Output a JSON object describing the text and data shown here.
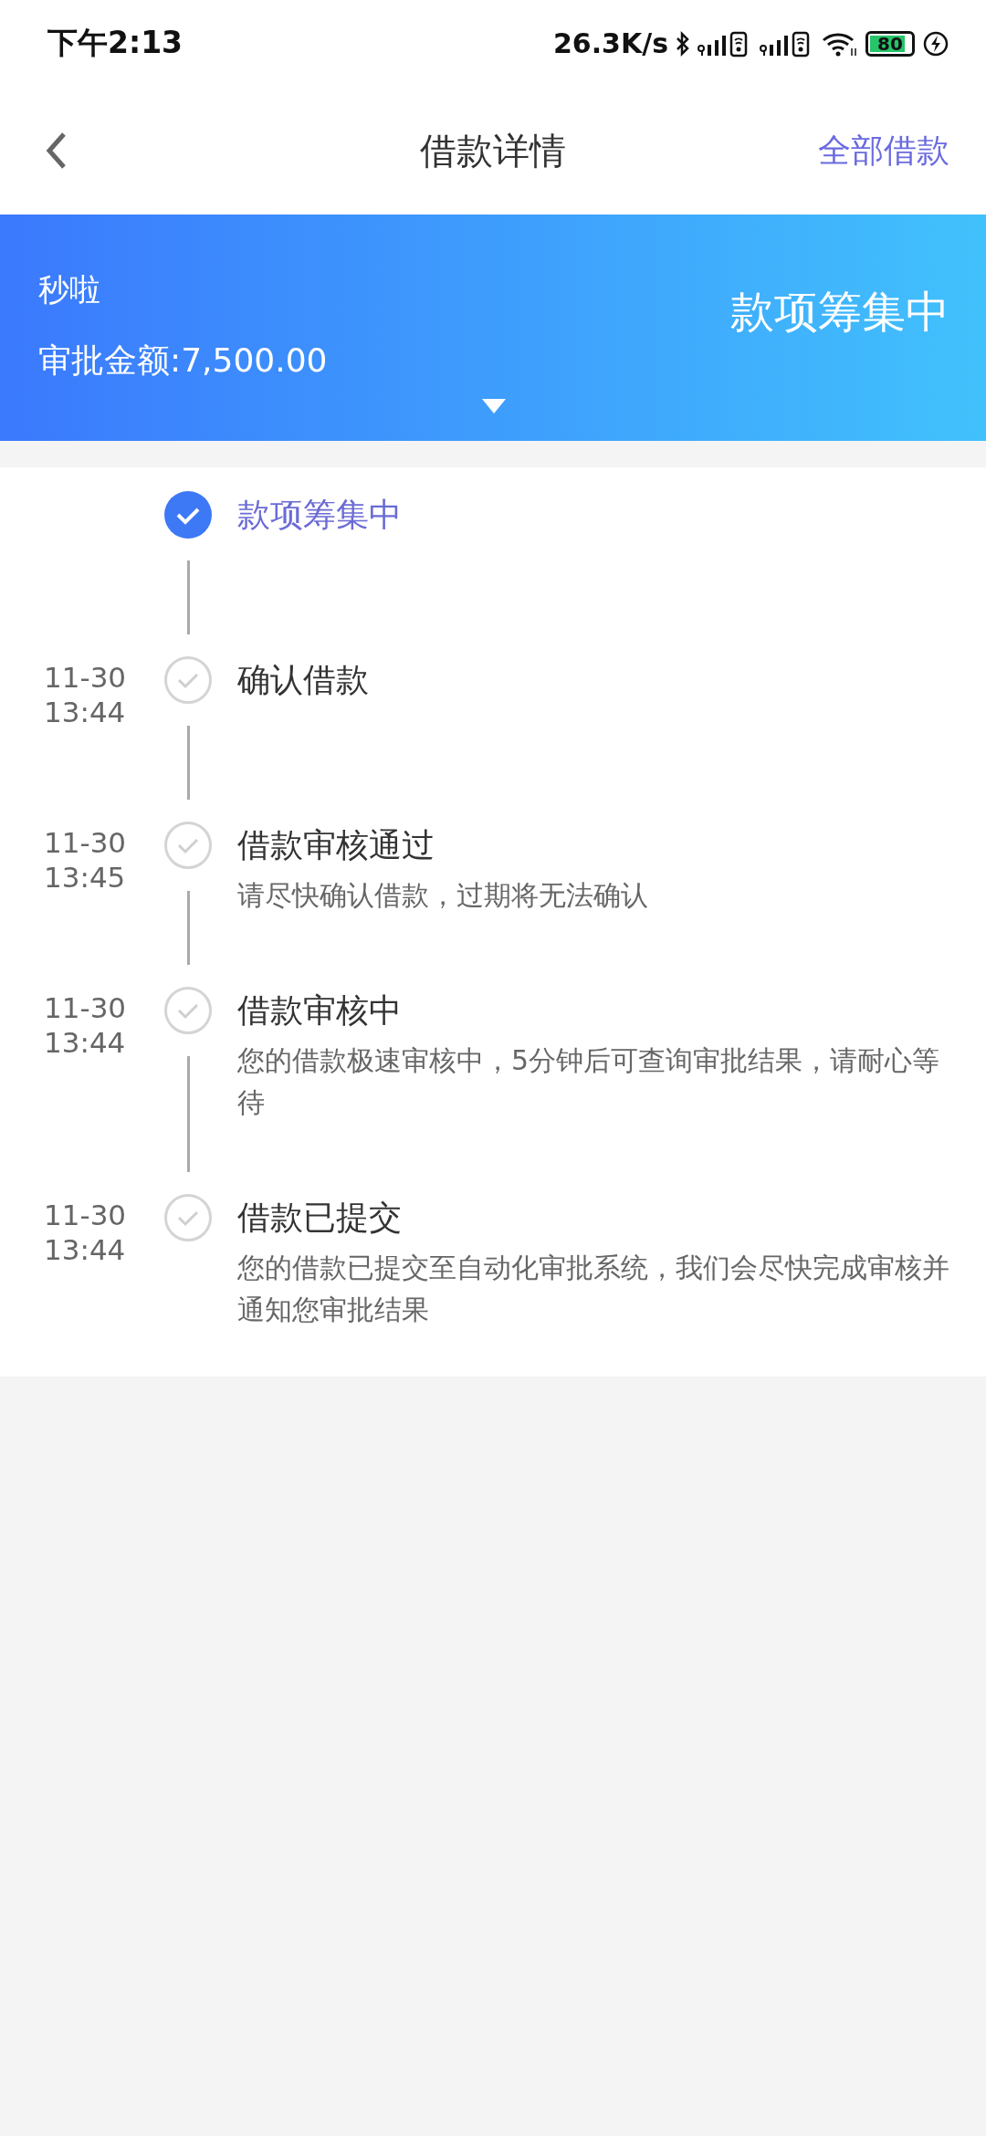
{
  "status_bar": {
    "time": "下午2:13",
    "net_speed": "26.3K/s",
    "battery": "80"
  },
  "header": {
    "title": "借款详情",
    "action": "全部借款"
  },
  "banner": {
    "name": "秒啦",
    "amount": "审批金额:7,500.00",
    "status": "款项筹集中"
  },
  "steps": [
    {
      "title": "款项筹集中",
      "active": true
    },
    {
      "date": "11-30",
      "time": "13:44",
      "title": "确认借款",
      "active": false
    },
    {
      "date": "11-30",
      "time": "13:45",
      "title": "借款审核通过",
      "description": "请尽快确认借款，过期将无法确认",
      "active": false
    },
    {
      "date": "11-30",
      "time": "13:44",
      "title": "借款审核中",
      "description": "您的借款极速审核中，5分钟后可查询审批结果，请耐心等待",
      "active": false
    },
    {
      "date": "11-30",
      "time": "13:44",
      "title": "借款已提交",
      "description": "您的借款已提交至自动化审批系统，我们会尽快完成审核并通知您审批结果",
      "active": false
    }
  ]
}
